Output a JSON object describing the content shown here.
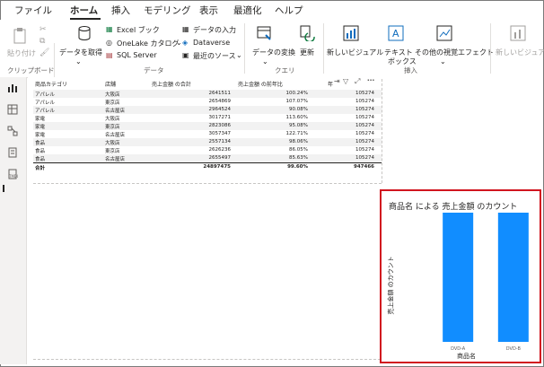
{
  "menu": {
    "items": [
      "ファイル",
      "ホーム",
      "挿入",
      "モデリング",
      "表示",
      "最適化",
      "ヘルプ"
    ],
    "active": "ホーム"
  },
  "ribbon": {
    "paste": "貼り付け",
    "get_data": "データを取得",
    "excel": "Excel ブック",
    "onelake": "OneLake カタログ",
    "sql": "SQL Server",
    "data_input": "データの入力",
    "dataverse": "Dataverse",
    "recent": "最近のソース",
    "transform": "データの変換",
    "refresh": "更新",
    "new_visual": "新しいビジュアル",
    "textbox": "テキスト\nボックス",
    "other_visual": "その他の視覚エフェクト",
    "new_visual_dis": "新しいビジュアル",
    "groups": {
      "clipboard": "クリップボード",
      "data": "データ",
      "query": "クエリ",
      "insert": "挿入"
    }
  },
  "table": {
    "headers": [
      "商品カテゴリ",
      "店舗",
      "売上金額 の合計",
      "売上金額 の前年比",
      "年"
    ],
    "rows": [
      [
        "アパレル",
        "大阪店",
        "2641511",
        "100.24%",
        "105274"
      ],
      [
        "アパレル",
        "東京店",
        "2654869",
        "107.07%",
        "105274"
      ],
      [
        "アパレル",
        "名古屋店",
        "2964524",
        "90.08%",
        "105274"
      ],
      [
        "家電",
        "大阪店",
        "3017271",
        "113.60%",
        "105274"
      ],
      [
        "家電",
        "東京店",
        "2823086",
        "95.08%",
        "105274"
      ],
      [
        "家電",
        "名古屋店",
        "3057347",
        "122.71%",
        "105274"
      ],
      [
        "食品",
        "大阪店",
        "2557134",
        "98.06%",
        "105274"
      ],
      [
        "食品",
        "東京店",
        "2626236",
        "86.05%",
        "105274"
      ],
      [
        "食品",
        "名古屋店",
        "2655497",
        "85.63%",
        "105274"
      ]
    ],
    "total": [
      "合計",
      "",
      "24897475",
      "99.60%",
      "947466"
    ]
  },
  "chart_data": {
    "type": "bar",
    "title": "商品名 による 売上金額 のカウント",
    "xlabel": "商品名",
    "ylabel": "売上金額 のカウント",
    "categories": [
      "DVD-A",
      "DVD-B"
    ],
    "values": [
      1,
      1
    ],
    "ylim": [
      0,
      1
    ],
    "bar_color": "#118dff"
  },
  "colors": {
    "accent_red": "#d1141f",
    "bar": "#118dff"
  }
}
